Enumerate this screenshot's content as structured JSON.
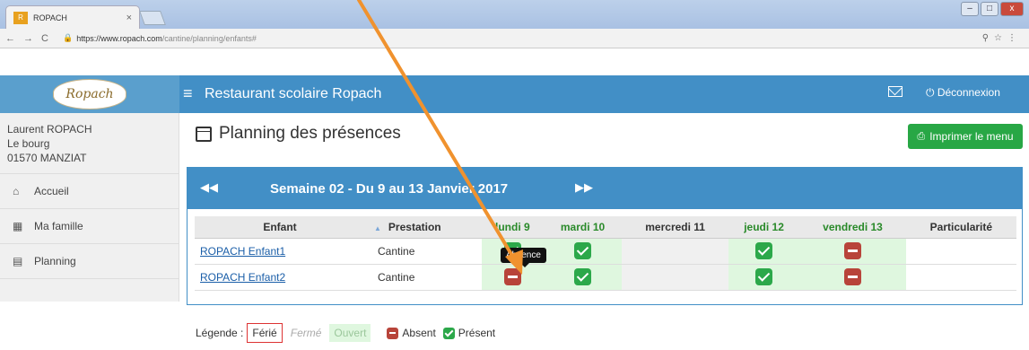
{
  "browser": {
    "tab_title": "ROPACH",
    "tab_close": "×",
    "url_host": "https://www.ropach.com",
    "url_path": "/cantine/planning/enfants#",
    "window_buttons": [
      "–",
      "□",
      "x"
    ]
  },
  "header": {
    "logo_text": "Ropach",
    "title": "Restaurant scolaire Ropach",
    "logout": "Déconnexion"
  },
  "user": {
    "name": "Laurent ROPACH",
    "address1": "Le bourg",
    "address2": "01570 MANZIAT"
  },
  "sidebar": {
    "items": [
      {
        "label": "Accueil",
        "icon": "home-icon"
      },
      {
        "label": "Ma famille",
        "icon": "grid-icon"
      },
      {
        "label": "Planning",
        "icon": "calendar-icon"
      }
    ]
  },
  "page": {
    "title": "Planning des présences",
    "print_label": "Imprimer le menu"
  },
  "week": {
    "title": "Semaine 02 - Du 9 au 13 Janvier 2017",
    "prev": "◀◀",
    "next": "▶▶"
  },
  "table": {
    "headers": {
      "enfant": "Enfant",
      "prestation": "Prestation",
      "days": [
        "lundi 9",
        "mardi 10",
        "mercredi 11",
        "jeudi 12",
        "vendredi 13"
      ],
      "particularite": "Particularité"
    },
    "rows": [
      {
        "name": "ROPACH Enfant1",
        "prestation": "Cantine",
        "states": [
          "present",
          "present",
          "closed",
          "present",
          "absent"
        ]
      },
      {
        "name": "ROPACH Enfant2",
        "prestation": "Cantine",
        "states": [
          "absent",
          "present",
          "closed",
          "present",
          "absent"
        ]
      }
    ]
  },
  "tooltip": "Absence",
  "legend": {
    "label": "Légende :",
    "ferie": "Férié",
    "ferme": "Fermé",
    "ouvert": "Ouvert",
    "absent": "Absent",
    "present": "Présent"
  },
  "colors": {
    "brand_blue": "#428fc6",
    "green": "#2ca84a",
    "red": "#b8443a",
    "open_day": "#dff7df",
    "arrow": "#f0922e"
  }
}
